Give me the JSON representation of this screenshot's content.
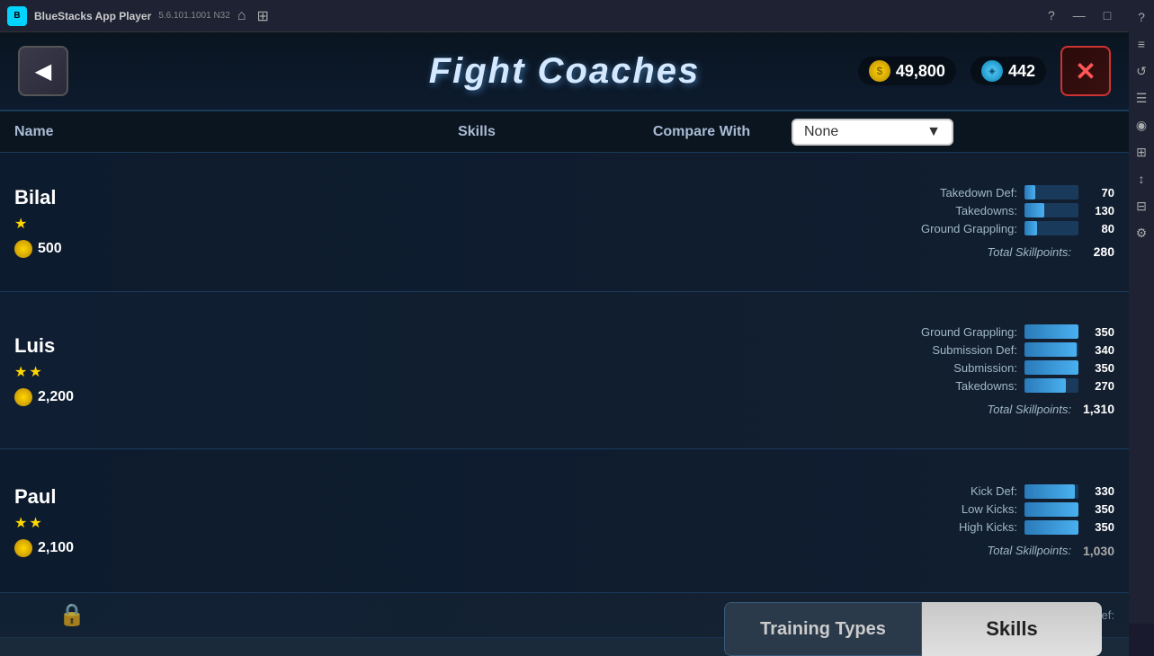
{
  "titlebar": {
    "app_name": "BlueStacks App Player",
    "version": "5.6.101.1001  N32",
    "nav_home": "⌂",
    "nav_grid": "⊞"
  },
  "header": {
    "title": "Fight Coaches",
    "back_label": "◀",
    "close_label": "✕",
    "coins_value": "49,800",
    "gems_value": "442"
  },
  "columns": {
    "name": "Name",
    "skills": "Skills",
    "compare_with": "Compare With",
    "dropdown_value": "None"
  },
  "coaches": [
    {
      "name": "Bilal",
      "stars": 1,
      "cost": "500",
      "skills": [
        {
          "label": "Takedown Def:",
          "value": "70",
          "pct": 20
        },
        {
          "label": "Takedowns:",
          "value": "130",
          "pct": 37
        },
        {
          "label": "Ground Grappling:",
          "value": "80",
          "pct": 23
        }
      ],
      "total_label": "Total Skillpoints:",
      "total_value": "280"
    },
    {
      "name": "Luis",
      "stars": 2,
      "cost": "2,200",
      "skills": [
        {
          "label": "Ground Grappling:",
          "value": "350",
          "pct": 100
        },
        {
          "label": "Submission Def:",
          "value": "340",
          "pct": 97
        },
        {
          "label": "Submission:",
          "value": "350",
          "pct": 100
        },
        {
          "label": "Takedowns:",
          "value": "270",
          "pct": 77
        }
      ],
      "total_label": "Total Skillpoints:",
      "total_value": "1,310"
    },
    {
      "name": "Paul",
      "stars": 2,
      "cost": "2,100",
      "skills": [
        {
          "label": "Kick Def:",
          "value": "330",
          "pct": 94
        },
        {
          "label": "Low Kicks:",
          "value": "350",
          "pct": 100
        },
        {
          "label": "High Kicks:",
          "value": "350",
          "pct": 100
        }
      ],
      "total_label": "Total Skillpoints:",
      "total_value": "1,030"
    }
  ],
  "partial_row": {
    "visible_label": "Submission Def:",
    "has_lock": true
  },
  "tabs": {
    "training_types": "Training Types",
    "skills": "Skills"
  },
  "sidebar_icons": [
    "?",
    "≡",
    "↺",
    "☰",
    "◉",
    "⚙",
    "↑",
    "⊞",
    "⚙"
  ],
  "titlebar_controls": [
    "?",
    "—",
    "□",
    "✕"
  ]
}
